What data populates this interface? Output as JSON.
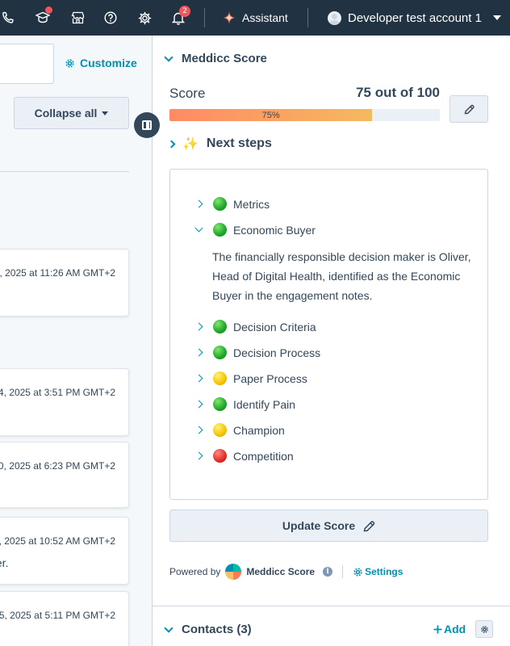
{
  "topnav": {
    "notifications_count": "2",
    "assistant_label": "Assistant",
    "account_name": "Developer test account 1",
    "icons": [
      "phone-icon",
      "academy-icon",
      "marketplace-icon",
      "help-icon",
      "settings-icon",
      "notifications-icon",
      "assistant-sparkle-icon",
      "avatar",
      "chevron-down-icon"
    ]
  },
  "left": {
    "customize_label": "Customize",
    "collapse_label": "Collapse all",
    "activities": [
      {
        "date": ", 2025 at 11:26 AM GMT+2",
        "extra": ""
      },
      {
        "date": "4, 2025 at 3:51 PM GMT+2",
        "extra": ""
      },
      {
        "date": "0, 2025 at 6:23 PM GMT+2",
        "extra": ""
      },
      {
        "date": ", 2025 at 10:52 AM GMT+2",
        "extra": "ter."
      },
      {
        "date": "5, 2025 at 5:11 PM GMT+2",
        "extra": ""
      }
    ]
  },
  "meddicc": {
    "section_title": "Meddicc Score",
    "score_label": "Score",
    "score_value": "75 out of 100",
    "progress_percent": 75,
    "progress_text": "75%",
    "next_steps_icon": "✨",
    "next_steps_label": "Next steps",
    "steps": [
      {
        "label": "Metrics",
        "status": "green",
        "expanded": false
      },
      {
        "label": "Economic Buyer",
        "status": "green",
        "expanded": true
      },
      {
        "label": "Decision Criteria",
        "status": "green",
        "expanded": false
      },
      {
        "label": "Decision Process",
        "status": "green",
        "expanded": false
      },
      {
        "label": "Paper Process",
        "status": "yellow",
        "expanded": false
      },
      {
        "label": "Identify Pain",
        "status": "green",
        "expanded": false
      },
      {
        "label": "Champion",
        "status": "yellow",
        "expanded": false
      },
      {
        "label": "Competition",
        "status": "red",
        "expanded": false
      }
    ],
    "economic_buyer_desc": "The financially responsible decision maker is Oliver, Head of Digital Health, identified as the Economic Buyer in the engagement notes.",
    "update_label": "Update Score",
    "powered_by": "Powered by",
    "brand_name": "Meddicc Score",
    "settings_label": "Settings"
  },
  "contacts": {
    "section_title": "Contacts (3)",
    "add_label": "Add"
  },
  "colors": {
    "nav_bg": "#213343",
    "accent": "#0091ae",
    "text": "#33475b",
    "progress_start": "#ff8a65",
    "progress_end": "#f5b95f"
  }
}
